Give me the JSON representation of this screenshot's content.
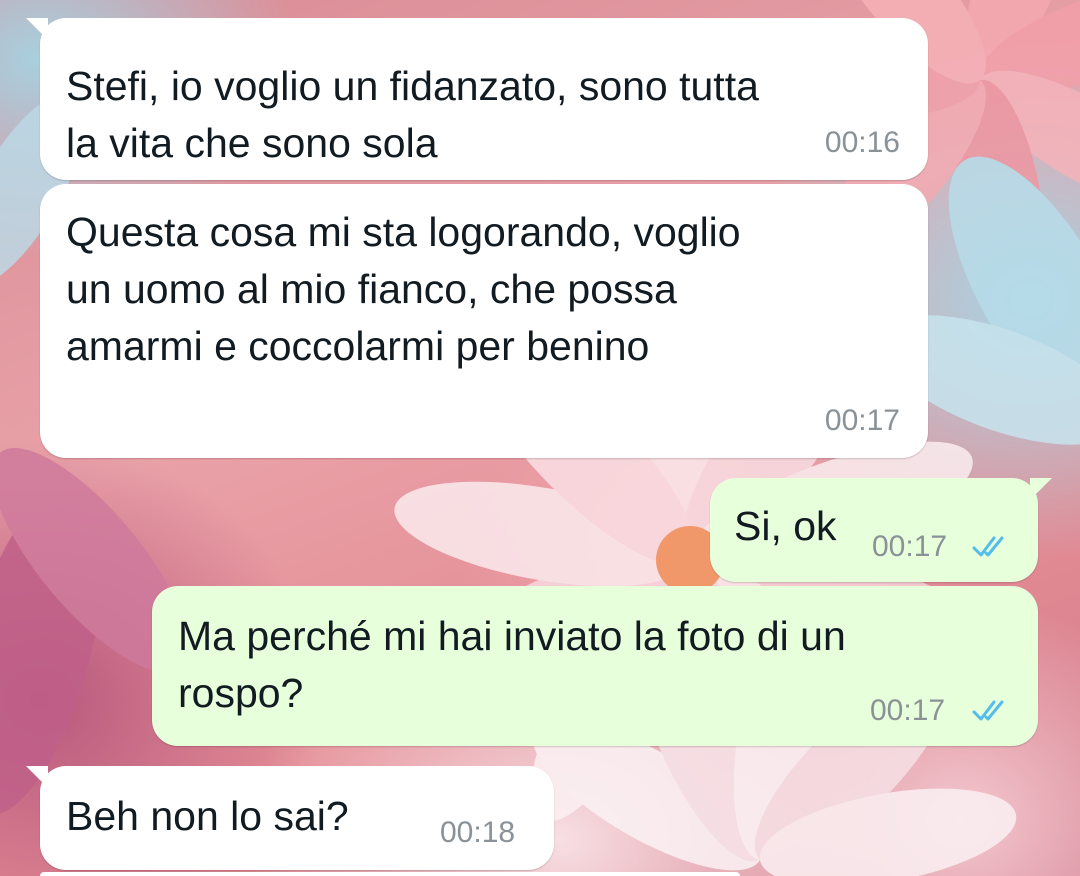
{
  "chat": {
    "messages": [
      {
        "direction": "incoming",
        "text": "Stefi, io voglio un fidanzato, sono tutta\nla vita che sono sola",
        "time": "00:16"
      },
      {
        "direction": "incoming",
        "text": "Questa cosa mi sta logorando, voglio\nun uomo al mio fianco, che possa\namarmi e coccolarmi per benino",
        "time": "00:17"
      },
      {
        "direction": "outgoing",
        "text": "Si, ok",
        "time": "00:17",
        "status_icon": "double-check-read-icon"
      },
      {
        "direction": "outgoing",
        "text": "Ma perché mi hai inviato la foto di un\nrospo?",
        "time": "00:17",
        "status_icon": "double-check-read-icon"
      },
      {
        "direction": "incoming",
        "text": "Beh non lo sai?",
        "time": "00:18"
      }
    ]
  },
  "colors": {
    "incoming_bubble": "#ffffff",
    "outgoing_bubble": "#e7ffdb",
    "read_ticks": "#53bdeb",
    "timestamp": "#8a9297"
  },
  "wallpaper": {
    "description_icon": "daisy-flowers-wallpaper"
  }
}
